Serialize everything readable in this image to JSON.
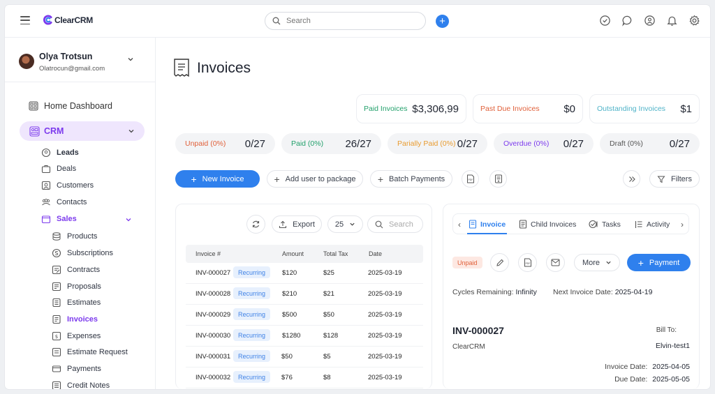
{
  "app": {
    "logo_text": "ClearCRM",
    "search_placeholder": "Search"
  },
  "user": {
    "name": "Olya Trotsun",
    "email": "Olatrocun@gmail.com"
  },
  "sidebar": {
    "home": "Home Dashboard",
    "crm": "CRM",
    "crm_items": [
      "Leads",
      "Deals",
      "Customers",
      "Contacts"
    ],
    "sales": "Sales",
    "sales_items": [
      "Products",
      "Subscriptions",
      "Contracts",
      "Proposals",
      "Estimates",
      "Invoices",
      "Expenses",
      "Estimate Request",
      "Payments",
      "Credit Notes"
    ]
  },
  "page": {
    "title": "Invoices"
  },
  "stats": [
    {
      "label": "Paid Invoices",
      "value": "$3,306,99",
      "color": "#22a06b"
    },
    {
      "label": "Past Due Invoices",
      "value": "$0",
      "color": "#e0603a"
    },
    {
      "label": "Outstanding Invoices",
      "value": "$1",
      "color": "#4fb3c8"
    }
  ],
  "pills": [
    {
      "label": "Unpaid (0%)",
      "value": "0/27",
      "color": "#e0603a"
    },
    {
      "label": "Paid (0%)",
      "value": "26/27",
      "color": "#22a06b"
    },
    {
      "label": "Parially Paid (0%)",
      "value": "0/27",
      "color": "#e89b2f"
    },
    {
      "label": "Overdue (0%)",
      "value": "0/27",
      "color": "#7c3aed"
    },
    {
      "label": "Draft (0%)",
      "value": "0/27",
      "color": "#555555"
    }
  ],
  "actions": {
    "new_invoice": "New Invoice",
    "add_user": "Add user to package",
    "batch_payments": "Batch Payments",
    "filters": "Filters"
  },
  "table_toolbar": {
    "export": "Export",
    "per_page": "25",
    "search_placeholder": "Search"
  },
  "table": {
    "headers": [
      "Invoice #",
      "Amount",
      "Total Tax",
      "Date"
    ],
    "rows": [
      {
        "invoice": "INV-000027",
        "status": "Recurring",
        "amount": "$120",
        "tax": "$25",
        "date": "2025-03-19"
      },
      {
        "invoice": "INV-000028",
        "status": "Recurring",
        "amount": "$210",
        "tax": "$21",
        "date": "2025-03-19"
      },
      {
        "invoice": "INV-000029",
        "status": "Recurring",
        "amount": "$500",
        "tax": "$50",
        "date": "2025-03-19"
      },
      {
        "invoice": "INV-000030",
        "status": "Recurring",
        "amount": "$1280",
        "tax": "$128",
        "date": "2025-03-19"
      },
      {
        "invoice": "INV-000031",
        "status": "Recurring",
        "amount": "$50",
        "tax": "$5",
        "date": "2025-03-19"
      },
      {
        "invoice": "INV-000032",
        "status": "Recurring",
        "amount": "$76",
        "tax": "$8",
        "date": "2025-03-19"
      }
    ]
  },
  "detail": {
    "tabs": [
      "Invoice",
      "Child Invoices",
      "Tasks",
      "Activity"
    ],
    "status": "Unpaid",
    "more": "More",
    "payment": "Payment",
    "cycles_label": "Cycles Remaining:",
    "cycles_value": "Infinity",
    "next_label": "Next Invoice Date:",
    "next_value": "2025-04-19",
    "invoice_no": "INV-000027",
    "company": "ClearCRM",
    "bill_to_label": "Bill To:",
    "bill_to_value": "Elvin-test1",
    "invoice_date_label": "Invoice Date:",
    "invoice_date_value": "2025-04-05",
    "due_date_label": "Due Date:",
    "due_date_value": "2025-05-05"
  }
}
